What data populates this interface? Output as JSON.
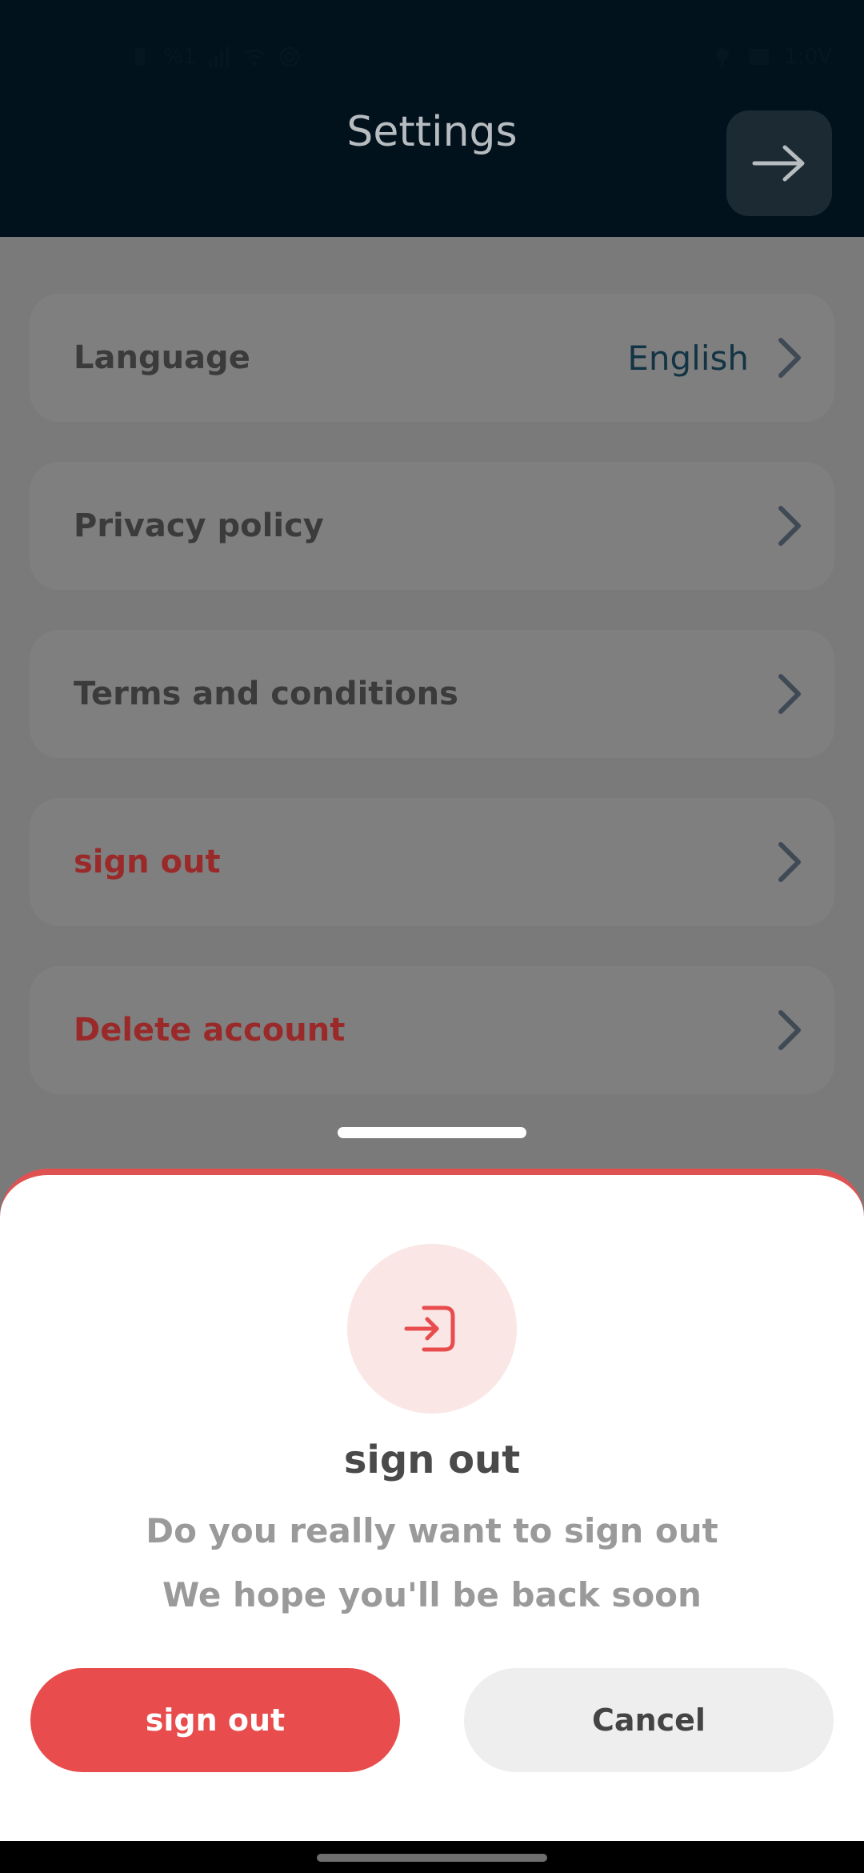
{
  "header": {
    "title": "Settings",
    "forward_icon": "arrow-right-icon",
    "status_left_text": "%1",
    "status_right_text": "1:0V"
  },
  "settings": {
    "items": [
      {
        "label": "Language",
        "value": "English",
        "icon": "chevron-right-icon"
      },
      {
        "label": "Privacy policy",
        "icon": "chevron-right-icon"
      },
      {
        "label": "Terms and conditions",
        "icon": "chevron-right-icon"
      },
      {
        "label": "sign out",
        "icon": "chevron-right-icon"
      },
      {
        "label": "Delete account",
        "icon": "chevron-right-icon"
      }
    ]
  },
  "sheet": {
    "icon": "sign-in-icon",
    "title": "sign out",
    "message_line1": "Do you really want to sign out",
    "message_line2": "We hope you'll be back soon",
    "confirm_label": "sign out",
    "cancel_label": "Cancel"
  },
  "colors": {
    "accent": "#e84c4c",
    "header_bg": "#01121d",
    "overlay_bg": "#7a7a7a"
  }
}
